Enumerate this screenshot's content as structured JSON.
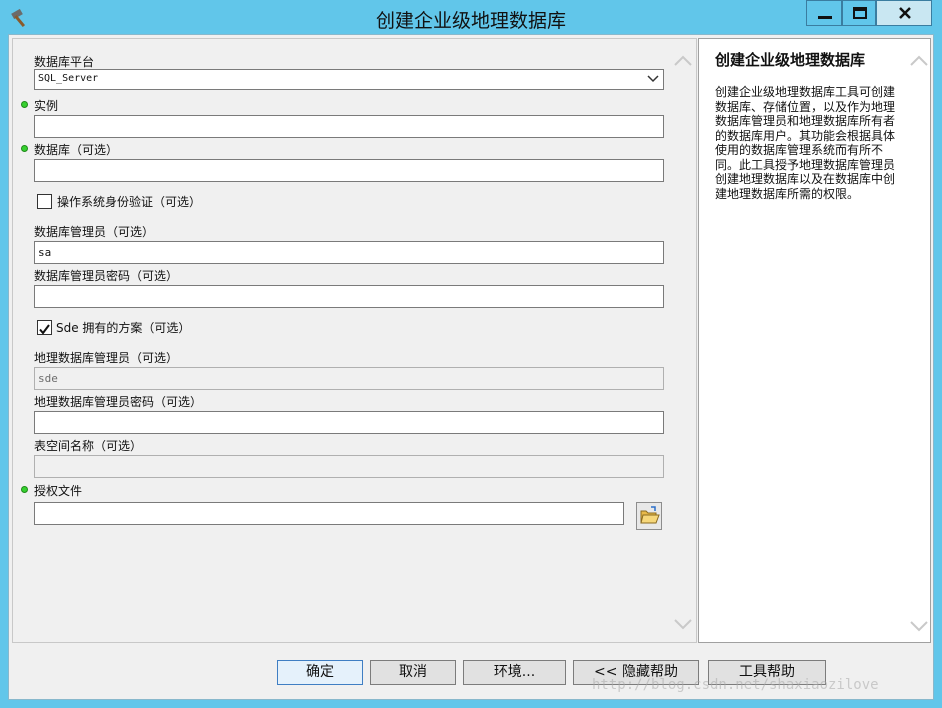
{
  "window": {
    "title": "创建企业级地理数据库",
    "icon": "hammer-icon"
  },
  "form": {
    "platform": {
      "label": "数据库平台",
      "value": "SQL_Server"
    },
    "instance": {
      "label": "实例",
      "value": ""
    },
    "database": {
      "label": "数据库（可选）",
      "value": ""
    },
    "os_auth": {
      "label": "操作系统身份验证（可选）",
      "checked": false
    },
    "db_admin": {
      "label": "数据库管理员（可选）",
      "value": "sa"
    },
    "db_admin_password": {
      "label": "数据库管理员密码（可选）",
      "value": ""
    },
    "sde_schema": {
      "label": "Sde 拥有的方案（可选）",
      "checked": true
    },
    "gdb_admin": {
      "label": "地理数据库管理员（可选）",
      "value": "sde"
    },
    "gdb_admin_password": {
      "label": "地理数据库管理员密码（可选）",
      "value": ""
    },
    "tablespace": {
      "label": "表空间名称（可选）",
      "value": ""
    },
    "license": {
      "label": "授权文件",
      "value": ""
    }
  },
  "help": {
    "title": "创建企业级地理数据库",
    "body": "创建企业级地理数据库工具可创建数据库、存储位置，以及作为地理数据库管理员和地理数据库所有者的数据库用户。其功能会根据具体使用的数据库管理系统而有所不同。此工具授予地理数据库管理员创建地理数据库以及在数据库中创建地理数据库所需的权限。"
  },
  "buttons": {
    "ok": "确定",
    "cancel": "取消",
    "env": "环境...",
    "hide_help": "<< 隐藏帮助",
    "tool_help": "工具帮助"
  },
  "watermark": "http://blog.csdn.net/shaxiaozilove",
  "colors": {
    "titlebar": "#61c6ea",
    "required_dot": "#36d02f"
  }
}
